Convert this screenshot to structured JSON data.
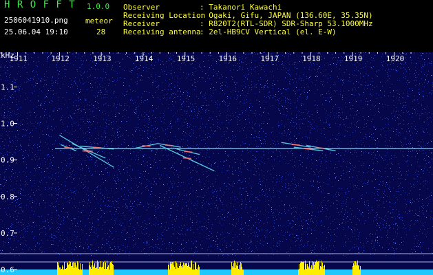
{
  "header": {
    "app_name": "H R O F F T",
    "version": "1.0.0",
    "filename": "2506041910.png",
    "timestamp": "25.06.04 19:10",
    "meteor_label": "meteor",
    "meteor_count": "28",
    "fields": [
      {
        "label": "Observer",
        "value": ": Takanori Kawachi"
      },
      {
        "label": "Receiving Location",
        "value": ": Ogaki, Gifu, JAPAN (136.60E, 35.35N)"
      },
      {
        "label": "Receiver",
        "value": ": R820T2(RTL-SDR) SDR-Sharp 53.1000MHz"
      },
      {
        "label": "Receiving antenna",
        "value": ": 2el-HB9CV Vertical (el. E-W)"
      }
    ]
  },
  "chart_data": {
    "type": "heatmap",
    "ylabel": "kHz",
    "x_ticks": [
      "1911",
      "1912",
      "1913",
      "1914",
      "1915",
      "1916",
      "1917",
      "1918",
      "1919",
      "1920"
    ],
    "y_ticks": [
      "1.1",
      "1.0",
      "0.9",
      "0.8",
      "0.7",
      "0.6"
    ],
    "y_values": [
      1.1,
      1.0,
      0.9,
      0.8,
      0.7,
      0.6
    ],
    "ylim": [
      0.585,
      1.195
    ],
    "carrier_khz": 0.932,
    "colors": {
      "background": "#06064a",
      "noise": "#2d44c8",
      "carrier": "#5fd8e8",
      "meteor": "#ff7070",
      "level_bar": "#ffee00",
      "level_base": "#1ec8ff",
      "ref_line": "#c8d2ff"
    },
    "meteor_traces": [
      {
        "x0": 1912.03,
        "x1": 1912.4,
        "y0": 0.942,
        "y1": 0.925
      },
      {
        "x0": 1912.0,
        "x1": 1913.3,
        "y0": 0.968,
        "y1": 0.88
      },
      {
        "x0": 1912.3,
        "x1": 1913.1,
        "y0": 0.945,
        "y1": 0.905
      },
      {
        "x0": 1912.5,
        "x1": 1913.3,
        "y0": 0.938,
        "y1": 0.93
      },
      {
        "x0": 1913.8,
        "x1": 1914.35,
        "y0": 0.932,
        "y1": 0.945
      },
      {
        "x0": 1914.35,
        "x1": 1914.9,
        "y0": 0.945,
        "y1": 0.935
      },
      {
        "x0": 1914.4,
        "x1": 1915.7,
        "y0": 0.94,
        "y1": 0.87
      },
      {
        "x0": 1914.8,
        "x1": 1915.35,
        "y0": 0.93,
        "y1": 0.915
      },
      {
        "x0": 1917.3,
        "x1": 1918.0,
        "y0": 0.948,
        "y1": 0.935
      },
      {
        "x0": 1917.6,
        "x1": 1918.3,
        "y0": 0.935,
        "y1": 0.925
      },
      {
        "x0": 1917.9,
        "x1": 1918.6,
        "y0": 0.94,
        "y1": 0.925
      }
    ],
    "level_bursts": [
      {
        "x0": 1911.95,
        "x1": 1912.55
      },
      {
        "x0": 1912.7,
        "x1": 1913.3
      },
      {
        "x0": 1914.6,
        "x1": 1915.35
      },
      {
        "x0": 1916.1,
        "x1": 1916.4
      },
      {
        "x0": 1917.7,
        "x1": 1918.35
      },
      {
        "x0": 1919.0,
        "x1": 1919.2
      }
    ]
  }
}
